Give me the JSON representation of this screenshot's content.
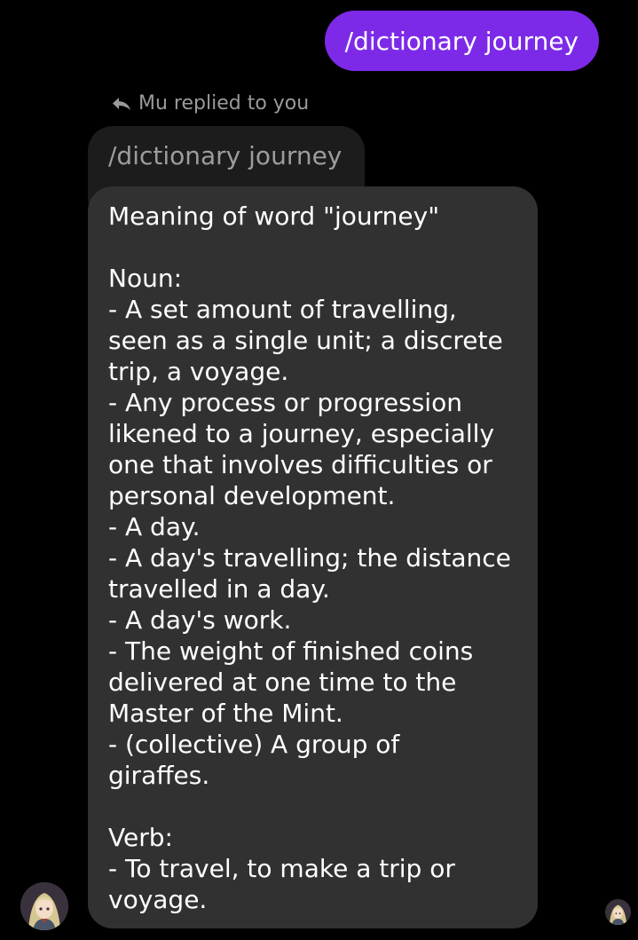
{
  "colors": {
    "background": "#000000",
    "sent_bubble": "#7d2ae8",
    "received_bubble": "#313131",
    "quoted_bubble": "#1c1c1c",
    "muted_text": "#9a9a9a"
  },
  "sent_message": {
    "text": "/dictionary journey"
  },
  "reply": {
    "icon": "reply-arrow-icon",
    "header": "Mu replied to you",
    "quoted_text": "/dictionary journey"
  },
  "answer": {
    "title": "Meaning of word \"journey\"",
    "noun_label": "Noun:",
    "noun_definitions": [
      "- A set amount of travelling,\nseen as a single unit; a discrete\ntrip, a voyage.",
      "- Any process or progression\nlikened to a journey, especially\none that involves difficulties or\npersonal development.",
      "- A day.",
      "- A day's travelling; the distance\ntravelled in a day.",
      "- A day's work.",
      "- The weight of finished coins\ndelivered at one time to the\nMaster of the Mint.",
      "- (collective) A group of\ngiraffes."
    ],
    "verb_label": "Verb:",
    "verb_definitions": [
      "- To travel, to make a trip or\nvoyage."
    ]
  },
  "avatars": {
    "sender_icon": "bot-avatar-icon",
    "read_receipt_icon": "read-receipt-avatar-icon"
  }
}
